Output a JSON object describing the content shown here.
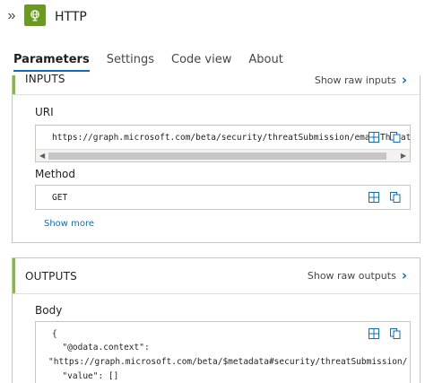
{
  "header": {
    "title": "HTTP",
    "collapse_icon": "double-chevron-right-icon",
    "app_icon": "globe-icon",
    "brand_color": "#6a9a1f"
  },
  "tabs": [
    {
      "label": "Parameters",
      "active": true
    },
    {
      "label": "Settings",
      "active": false
    },
    {
      "label": "Code view",
      "active": false
    },
    {
      "label": "About",
      "active": false
    }
  ],
  "inputs": {
    "title": "INPUTS",
    "raw_link": "Show raw inputs",
    "uri": {
      "label": "URI",
      "value": "https://graph.microsoft.com/beta/security/threatSubmission/emailThreat"
    },
    "method": {
      "label": "Method",
      "value": "GET"
    },
    "show_more": "Show more"
  },
  "outputs": {
    "title": "OUTPUTS",
    "raw_link": "Show raw outputs",
    "body": {
      "label": "Body",
      "lines": [
        "{",
        "  \"@odata.context\":",
        "\"https://graph.microsoft.com/beta/$metadata#security/threatSubmission/",
        "  \"value\": []"
      ]
    }
  },
  "accent_color": "#0f6cbd"
}
